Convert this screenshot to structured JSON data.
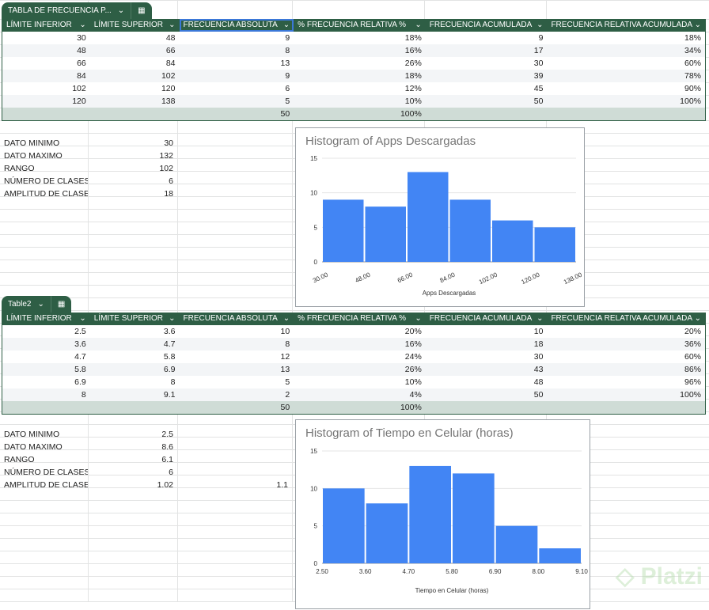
{
  "colors": {
    "header": "#2e5e45",
    "bar": "#4285f4",
    "total": "#cfdcd6"
  },
  "headers": [
    "LÍMITE INFERIOR",
    "LÍMITE SUPERIOR",
    "FRECUENCIA ABSOLUTA",
    "FRECUENCIA RELATIVA %",
    "FRECUENCIA ACUMULADA",
    "FRECUENCIA RELATIVA ACUMULADA"
  ],
  "percent_icon": "%",
  "table1": {
    "name": "TABLA DE FRECUENCIA P...",
    "rows": [
      [
        "30",
        "48",
        "9",
        "18%",
        "9",
        "18%"
      ],
      [
        "48",
        "66",
        "8",
        "16%",
        "17",
        "34%"
      ],
      [
        "66",
        "84",
        "13",
        "26%",
        "30",
        "60%"
      ],
      [
        "84",
        "102",
        "9",
        "18%",
        "39",
        "78%"
      ],
      [
        "102",
        "120",
        "6",
        "12%",
        "45",
        "90%"
      ],
      [
        "120",
        "138",
        "5",
        "10%",
        "50",
        "100%"
      ]
    ],
    "total": [
      "",
      "",
      "50",
      "100%",
      "",
      ""
    ],
    "stats": [
      [
        "DATO MINIMO",
        "30",
        ""
      ],
      [
        "DATO MAXIMO",
        "132",
        ""
      ],
      [
        "RANGO",
        "102",
        ""
      ],
      [
        "NÚMERO DE CLASES",
        "6",
        ""
      ],
      [
        "AMPLITUD DE CLASE",
        "18",
        ""
      ]
    ]
  },
  "table2": {
    "name": "Table2",
    "rows": [
      [
        "2.5",
        "3.6",
        "10",
        "20%",
        "10",
        "20%"
      ],
      [
        "3.6",
        "4.7",
        "8",
        "16%",
        "18",
        "36%"
      ],
      [
        "4.7",
        "5.8",
        "12",
        "24%",
        "30",
        "60%"
      ],
      [
        "5.8",
        "6.9",
        "13",
        "26%",
        "43",
        "86%"
      ],
      [
        "6.9",
        "8",
        "5",
        "10%",
        "48",
        "96%"
      ],
      [
        "8",
        "9.1",
        "2",
        "4%",
        "50",
        "100%"
      ]
    ],
    "total": [
      "",
      "",
      "50",
      "100%",
      "",
      ""
    ],
    "stats": [
      [
        "DATO MINIMO",
        "2.5",
        ""
      ],
      [
        "DATO MAXIMO",
        "8.6",
        ""
      ],
      [
        "RANGO",
        "6.1",
        ""
      ],
      [
        "NÚMERO DE CLASES",
        "6",
        ""
      ],
      [
        "AMPLITUD DE CLASE",
        "1.02",
        "1.1"
      ]
    ]
  },
  "chart_data": [
    {
      "type": "bar",
      "title": "Histogram of Apps Descargadas",
      "xlabel": "Apps Descargadas",
      "ylabel": "",
      "ylim": [
        0,
        15
      ],
      "yticks": [
        "0",
        "5",
        "10",
        "15"
      ],
      "xticks": [
        "30.00",
        "48.00",
        "66.00",
        "84.00",
        "102.00",
        "120.00",
        "138.00"
      ],
      "values": [
        9,
        8,
        13,
        9,
        6,
        5
      ],
      "rotated": true
    },
    {
      "type": "bar",
      "title": "Histogram of Tiempo en Celular (horas)",
      "xlabel": "Tiempo en Celular (horas)",
      "ylabel": "",
      "ylim": [
        0,
        15
      ],
      "yticks": [
        "0",
        "5",
        "10",
        "15"
      ],
      "xticks": [
        "2.50",
        "3.60",
        "4.70",
        "5.80",
        "6.90",
        "8.00",
        "9.10"
      ],
      "values": [
        10,
        8,
        13,
        12,
        5,
        2
      ],
      "rotated": false
    }
  ],
  "watermark": "Platzi"
}
